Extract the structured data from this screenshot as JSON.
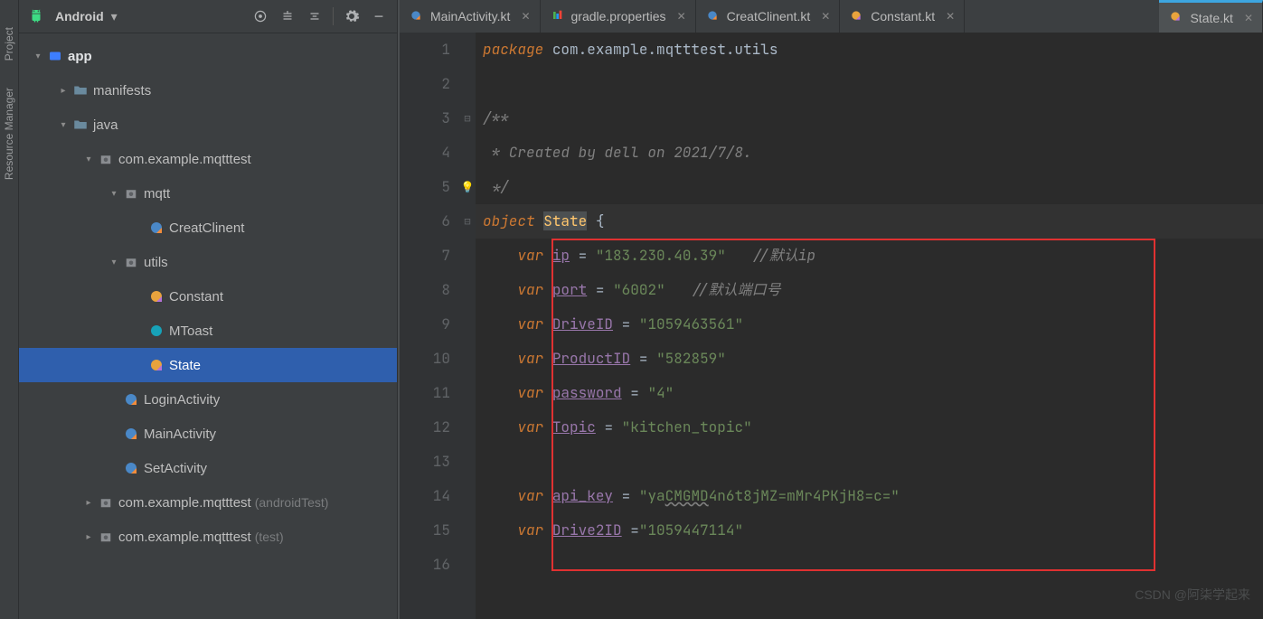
{
  "left_strip": {
    "project": "Project",
    "resource": "Resource Manager"
  },
  "sidebar": {
    "header_title": "Android"
  },
  "tree": {
    "app": "app",
    "manifests": "manifests",
    "java": "java",
    "pkg_main": "com.example.mqtttest",
    "mqtt": "mqtt",
    "creatclinent": "CreatClinent",
    "utils": "utils",
    "constant": "Constant",
    "mtoast": "MToast",
    "state": "State",
    "loginactivity": "LoginActivity",
    "mainactivity": "MainActivity",
    "setactivity": "SetActivity",
    "pkg_atest": "com.example.mqtttest",
    "pkg_atest_hint": "(androidTest)",
    "pkg_test": "com.example.mqtttest",
    "pkg_test_hint": "(test)"
  },
  "tabs": [
    {
      "label": "MainActivity.kt",
      "type": "kt"
    },
    {
      "label": "gradle.properties",
      "type": "gradle"
    },
    {
      "label": "CreatClinent.kt",
      "type": "kt"
    },
    {
      "label": "Constant.kt",
      "type": "kt"
    },
    {
      "label": "State.kt",
      "type": "kt"
    }
  ],
  "code_lines": {
    "package_kw": "package",
    "package_name": "com.example.mqtttest.utils",
    "comment_open": "/**",
    "comment_body": " * Created by dell on 2021/7/8.",
    "comment_close": " */",
    "object_kw": "object",
    "object_name": "State",
    "brace_open": "{",
    "var_kw": "var",
    "ip": "ip",
    "ip_val": "\"183.230.40.39\"",
    "ip_cmt": "//默认ip",
    "port": "port",
    "port_val": "\"6002\"",
    "port_cmt": "//默认端口号",
    "driveid": "DriveID",
    "driveid_val": "\"1059463561\"",
    "productid": "ProductID",
    "productid_val": "\"582859\"",
    "password": "password",
    "password_val": "\"4\"",
    "topic": "Topic",
    "topic_val": "\"kitchen_topic\"",
    "api_key": "api_key",
    "api_key_val_pre": "\"ya",
    "api_key_val_wavy": "CMGMD",
    "api_key_val_post": "4n6t8jMZ=mMr4PKjH8=c=\"",
    "drive2id": "Drive2ID",
    "drive2id_val": "\"1059447114\""
  },
  "line_numbers": [
    "1",
    "2",
    "3",
    "4",
    "5",
    "6",
    "7",
    "8",
    "9",
    "10",
    "11",
    "12",
    "13",
    "14",
    "15",
    "16"
  ],
  "watermark": "CSDN @阿柒学起来"
}
